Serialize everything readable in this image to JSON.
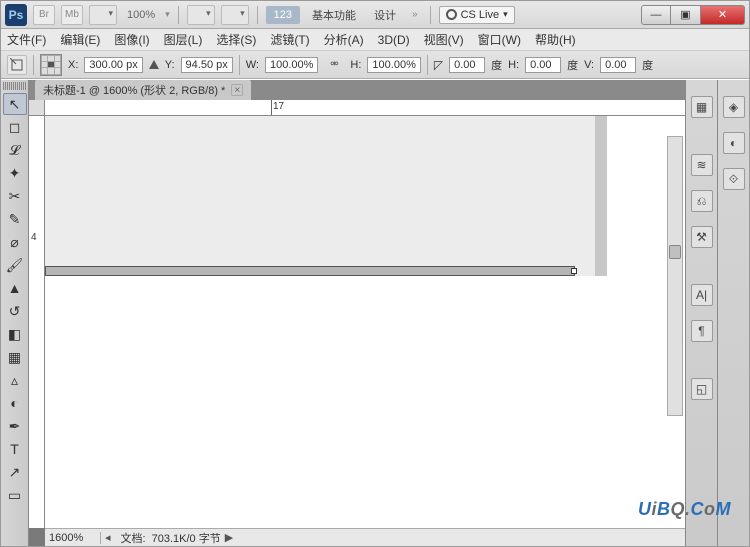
{
  "title": {
    "ps": "Ps",
    "br": "Br",
    "mb": "Mb",
    "zoom_pct": "100%",
    "btn123": "123",
    "tab_basic": "基本功能",
    "tab_design": "设计",
    "cslive": "CS Live",
    "min": "—",
    "max": "▣",
    "close": "✕"
  },
  "menu": [
    "文件(F)",
    "编辑(E)",
    "图像(I)",
    "图层(L)",
    "选择(S)",
    "滤镜(T)",
    "分析(A)",
    "3D(D)",
    "视图(V)",
    "窗口(W)",
    "帮助(H)"
  ],
  "options": {
    "x_label": "X:",
    "x_value": "300.00 px",
    "y_label": "Y:",
    "y_value": "94.50 px",
    "w_label": "W:",
    "w_value": "100.00%",
    "h_label": "H:",
    "h_value": "100.00%",
    "angle_value": "0.00",
    "angle_unit": "度",
    "skew_h_label": "H:",
    "skew_h_value": "0.00",
    "skew_h_unit": "度",
    "skew_v_label": "V:",
    "skew_v_value": "0.00",
    "skew_v_unit": "度"
  },
  "doc": {
    "tab_title": "未标题-1 @ 1600% (形状 2, RGB/8) *",
    "ruler_h_num": "17",
    "ruler_v_num": "4"
  },
  "status": {
    "zoom": "1600%",
    "docinfo_label": "文档:",
    "docinfo_value": "703.1K/0 字节",
    "arrow": "▶"
  },
  "watermark": {
    "u": "U",
    "i": "i",
    "b": "B",
    "q": "Q",
    "dot": ".",
    "c": "C",
    "o": "o",
    "m": "M"
  }
}
